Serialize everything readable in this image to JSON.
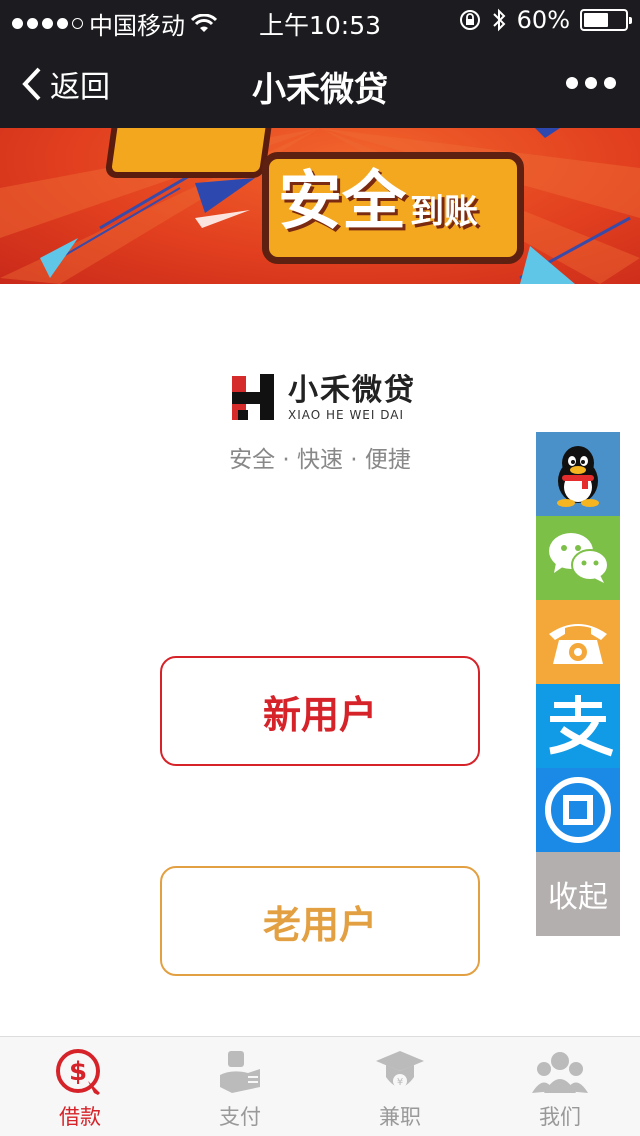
{
  "status_bar": {
    "carrier": "中国移动",
    "time": "上午10:53",
    "battery_text": "60%",
    "battery_level": 0.6
  },
  "nav": {
    "back_label": "返回",
    "title": "小禾微贷"
  },
  "banner": {
    "text_big": "安全",
    "text_small": "到账"
  },
  "logo": {
    "cn": "小禾微贷",
    "en": "XIAO HE WEI DAI"
  },
  "slogan": "安全 · 快速 · 便捷",
  "buttons": {
    "new_user": "新用户",
    "old_user": "老用户"
  },
  "side_bar": {
    "items": [
      {
        "icon": "qq-icon"
      },
      {
        "icon": "wechat-icon"
      },
      {
        "icon": "phone-icon"
      },
      {
        "icon": "alipay-icon"
      },
      {
        "icon": "payment-icon"
      }
    ],
    "collapse_label": "收起"
  },
  "tab_bar": {
    "tabs": [
      {
        "label": "借款",
        "icon": "loan-icon",
        "active": true
      },
      {
        "label": "支付",
        "icon": "payment-hand-icon",
        "active": false
      },
      {
        "label": "兼职",
        "icon": "graduate-icon",
        "active": false
      },
      {
        "label": "我们",
        "icon": "people-icon",
        "active": false
      }
    ]
  },
  "colors": {
    "accent_red": "#d6232a",
    "accent_orange": "#e3a042",
    "nav_bg": "#1c1c20"
  }
}
